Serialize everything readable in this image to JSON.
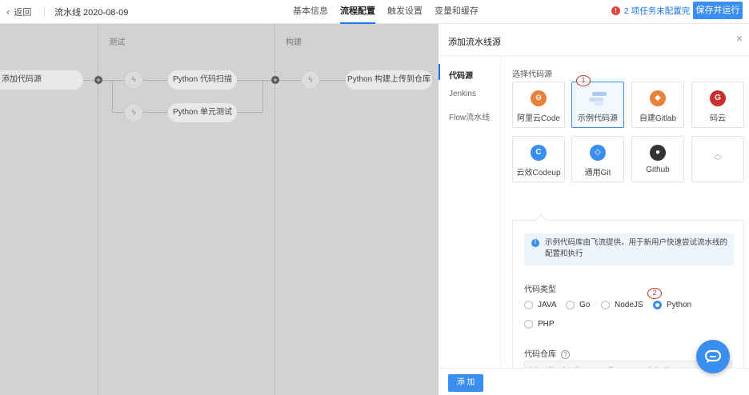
{
  "header": {
    "back_label": "返回",
    "pipeline_title": "流水线 2020-08-09",
    "tabs": [
      {
        "label": "基本信息"
      },
      {
        "label": "流程配置",
        "active": true
      },
      {
        "label": "触发设置"
      },
      {
        "label": "变量和缓存"
      }
    ],
    "warning_count": "!",
    "warning_text": "2 项任务未配置完",
    "save_run_label": "保存并运行",
    "accent": "#3a8ef0"
  },
  "canvas": {
    "stages": [
      {
        "label": "测试"
      },
      {
        "label": "构建"
      }
    ],
    "source_node": "添加代码源",
    "jobs": [
      {
        "label": "Python 代码扫描"
      },
      {
        "label": "Python 单元测试"
      },
      {
        "label": "Python 构建上传到仓库"
      }
    ],
    "add_symbol": "+",
    "bolt_icon": "ϟ"
  },
  "drawer": {
    "title": "添加流水线源",
    "close_icon": "×",
    "nav": [
      {
        "label": "代码源",
        "active": true
      },
      {
        "label": "Jenkins"
      },
      {
        "label": "Flow流水线"
      }
    ],
    "section_label": "选择代码源",
    "sources": [
      {
        "name": "阿里云Code",
        "icon": "code-icon",
        "glyph": "⊖",
        "color": "#e8823a"
      },
      {
        "name": "示例代码源",
        "icon": "sample-icon",
        "glyph": "",
        "color": "#8fb8ea",
        "selected": true
      },
      {
        "name": "自建Gitlab",
        "icon": "gitlab-icon",
        "glyph": "◆",
        "color": "#e8823a"
      },
      {
        "name": "码云",
        "icon": "gitee-icon",
        "glyph": "G",
        "color": "#c9302c"
      },
      {
        "name": "云效Codeup",
        "icon": "codeup-icon",
        "glyph": "C",
        "color": "#3a8ef0"
      },
      {
        "name": "通用Git",
        "icon": "git-icon",
        "glyph": "◇",
        "color": "#3a8ef0"
      },
      {
        "name": "Github",
        "icon": "github-icon",
        "glyph": "●",
        "color": "#333333"
      }
    ],
    "expand_icon": "⌃⌄",
    "annotation_1": "1",
    "annotation_2": "2",
    "info_icon": "!",
    "info_text": "示例代码库由飞流提供，用于新用户快速尝试流水线的配置和执行",
    "code_type_label": "代码类型",
    "code_types": [
      {
        "label": "JAVA"
      },
      {
        "label": "Go"
      },
      {
        "label": "NodeJS"
      },
      {
        "label": "Python",
        "selected": true
      },
      {
        "label": "PHP"
      }
    ],
    "repo_label": "代码仓库",
    "help_icon": "?",
    "repo_value": "https://code.aliyun.com/flow-example/python-te",
    "add_label": "添 加"
  }
}
